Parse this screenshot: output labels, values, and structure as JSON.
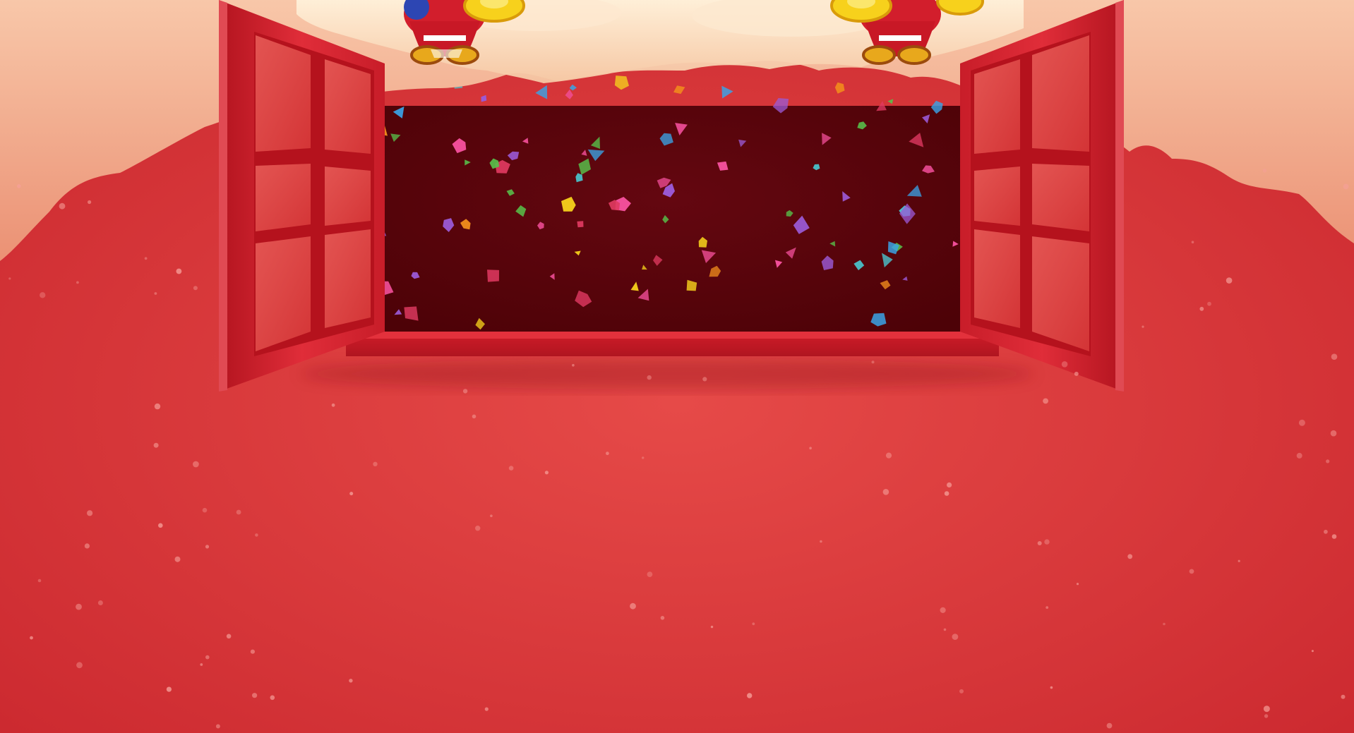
{
  "scene": {
    "background_color": "#d93a3a",
    "floor_color": "#e24444",
    "cloud_color": "#f2a385",
    "interior_color": "#5c0309",
    "window_frame_color": "#d4212f",
    "sill_color": "#c41726",
    "confetti_colors": [
      "#f24f9a",
      "#3aa3e6",
      "#f6d21c",
      "#58c14b",
      "#f28d1c",
      "#e03a61",
      "#9b5ad6",
      "#4ac0c9"
    ],
    "icons": [
      "cloud-icon",
      "open-window-icon",
      "fortune-god-icon",
      "gold-ingot-icon",
      "confetti-icon"
    ]
  }
}
